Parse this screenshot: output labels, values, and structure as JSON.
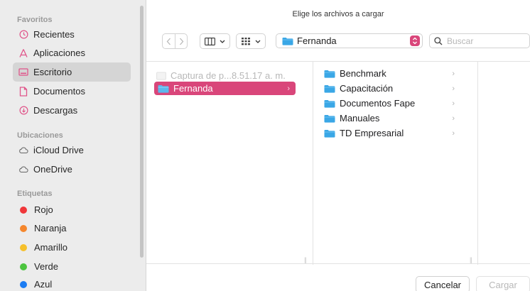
{
  "dialog": {
    "title": "Elige los archivos a cargar"
  },
  "sidebar": {
    "favorites_header": "Favoritos",
    "favorites": [
      {
        "label": "Recientes",
        "icon": "clock-icon"
      },
      {
        "label": "Aplicaciones",
        "icon": "applications-icon"
      },
      {
        "label": "Escritorio",
        "icon": "desktop-icon",
        "selected": true
      },
      {
        "label": "Documentos",
        "icon": "document-icon"
      },
      {
        "label": "Descargas",
        "icon": "download-icon"
      }
    ],
    "locations_header": "Ubicaciones",
    "locations": [
      {
        "label": "iCloud Drive",
        "icon": "cloud-icon"
      },
      {
        "label": "OneDrive",
        "icon": "cloud-icon"
      }
    ],
    "tags_header": "Etiquetas",
    "tags": [
      {
        "label": "Rojo",
        "color": "#f0373a"
      },
      {
        "label": "Naranja",
        "color": "#f5872d"
      },
      {
        "label": "Amarillo",
        "color": "#f6c02b"
      },
      {
        "label": "Verde",
        "color": "#4cc43f"
      },
      {
        "label": "Azul",
        "color": "#1b7cf3"
      }
    ]
  },
  "toolbar": {
    "location_popup": "Fernanda",
    "search_placeholder": "Buscar"
  },
  "browser": {
    "column1": [
      {
        "label": "Captura de p...8.51.17 a. m.",
        "disabled": true
      },
      {
        "label": "Fernanda",
        "selected": true
      }
    ],
    "column2": [
      {
        "label": "Benchmark"
      },
      {
        "label": "Capacitación"
      },
      {
        "label": "Documentos Fape"
      },
      {
        "label": "Manuales"
      },
      {
        "label": "TD Empresarial"
      }
    ]
  },
  "buttons": {
    "cancel": "Cancelar",
    "load": "Cargar"
  },
  "colors": {
    "accent": "#d9467a",
    "folder": "#3aa7e6",
    "sidebar_icon": "#e0558a"
  }
}
